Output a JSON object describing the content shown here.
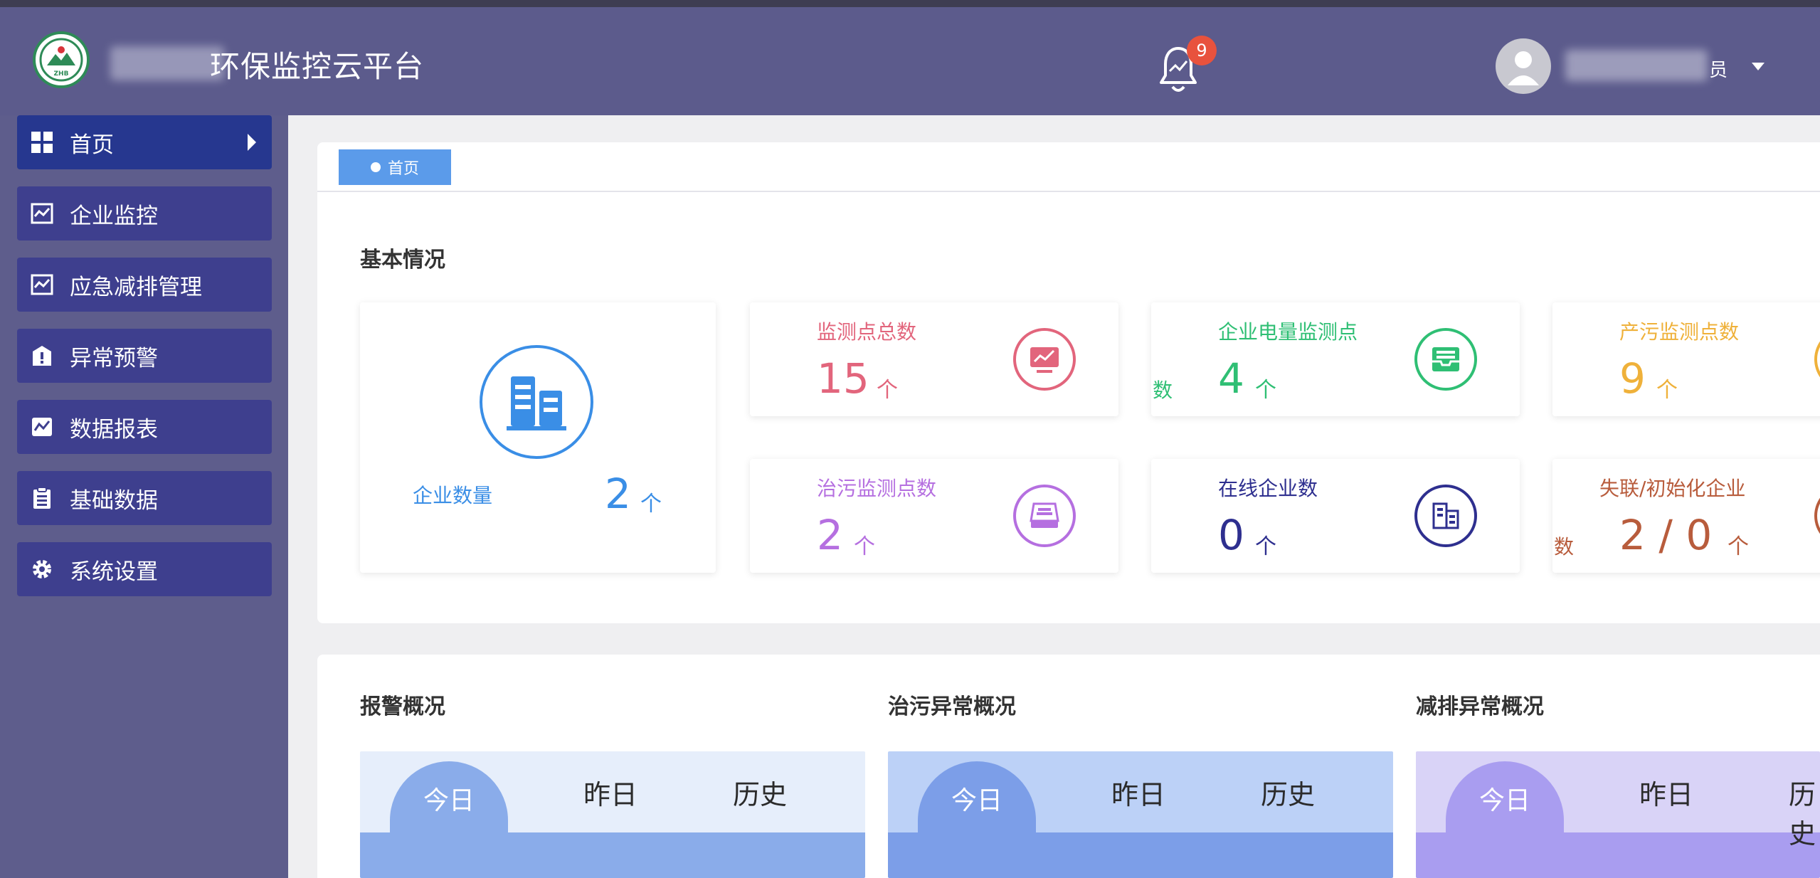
{
  "header": {
    "app_title": "环保监控云平台",
    "logo_text": "ZHB",
    "notification_count": "9",
    "user_role_suffix": "员"
  },
  "sidebar": {
    "items": [
      {
        "label": "首页",
        "icon": "grid-icon",
        "active": true
      },
      {
        "label": "企业监控",
        "icon": "line-chart-icon"
      },
      {
        "label": "应急减排管理",
        "icon": "line-chart-icon"
      },
      {
        "label": "异常预警",
        "icon": "warning-shield-icon"
      },
      {
        "label": "数据报表",
        "icon": "report-chart-icon"
      },
      {
        "label": "基础数据",
        "icon": "clipboard-icon"
      },
      {
        "label": "系统设置",
        "icon": "gear-icon"
      }
    ]
  },
  "breadcrumb": {
    "tab_label": "首页"
  },
  "basic": {
    "title": "基本情况",
    "enterprise": {
      "label": "企业数量",
      "value": "2",
      "unit": "个",
      "color": "#3a8ee6"
    },
    "stats": [
      {
        "label": "监测点总数",
        "value": "15",
        "unit": "个",
        "color": "#e2657c"
      },
      {
        "label": "企业电量监测点",
        "prefix": "数",
        "value": "4",
        "unit": "个",
        "color": "#2fbf74"
      },
      {
        "label": "产污监测点数",
        "value": "9",
        "unit": "个",
        "color": "#efb13a"
      },
      {
        "label": "治污监测点数",
        "value": "2",
        "unit": "个",
        "color": "#b56fe0"
      },
      {
        "label": "在线企业数",
        "value": "0",
        "unit": "个",
        "color": "#2e2f8f"
      },
      {
        "label": "失联/初始化企业",
        "prefix": "数",
        "value": "2 / 0",
        "unit": "个",
        "color": "#b85c3c"
      }
    ]
  },
  "overview": {
    "sections": [
      {
        "title": "报警概况",
        "tabs": [
          "今日",
          "昨日",
          "历史"
        ]
      },
      {
        "title": "治污异常概况",
        "tabs": [
          "今日",
          "昨日",
          "历史"
        ]
      },
      {
        "title": "减排异常概况",
        "tabs": [
          "今日",
          "昨日",
          "历史"
        ]
      }
    ]
  }
}
